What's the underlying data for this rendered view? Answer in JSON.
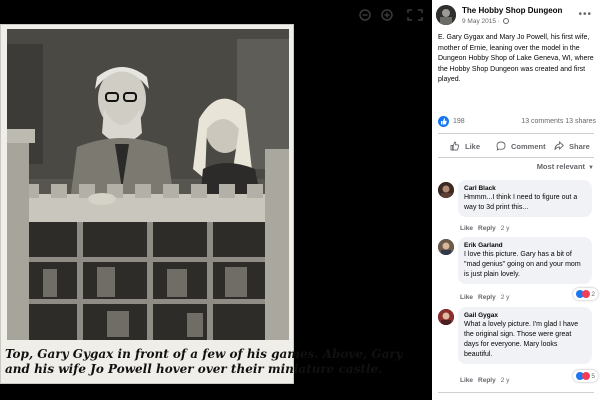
{
  "caption": {
    "lines": [
      "Top, Gary Gygax in front of a few of his games. Above, Gary",
      "and his wife Jo Powell hover over their miniature castle."
    ]
  },
  "post": {
    "page_name": "The Hobby Shop Dungeon",
    "date": "9 May 2015",
    "text": "E. Gary Gygax and Mary Jo Powell, his first wife, mother of Ernie, leaning over the model in the Dungeon Hobby Shop of Lake Geneva, WI, where the Hobby Shop Dungeon was created and first played.",
    "reaction_count": "198",
    "comments_shares": "13 comments  13 shares",
    "actions": {
      "like": "Like",
      "comment": "Comment",
      "share": "Share"
    },
    "sort_label": "Most relevant"
  },
  "comments": [
    {
      "author": "Carl Black",
      "text": "Hmmm...I think I need to figure out a way to 3d print this...",
      "like": "Like",
      "reply": "Reply",
      "age": "2 y",
      "reactions": ""
    },
    {
      "author": "Erik Garland",
      "text": "I love this picture. Gary has a bit of \"mad genius\" going on and your mom is just plain lovely.",
      "like": "Like",
      "reply": "Reply",
      "age": "2 y",
      "reactions": "2"
    },
    {
      "author": "Gail Gygax",
      "text": "What a lovely picture. I'm glad I have the original sign. Those were great days for everyone. Mary looks beautiful.",
      "like": "Like",
      "reply": "Reply",
      "age": "2 y",
      "reactions": "5"
    }
  ],
  "colors": {
    "accent": "#1877f2",
    "love": "#f33e58",
    "muted": "#65676b",
    "bubble": "#f0f2f5"
  }
}
